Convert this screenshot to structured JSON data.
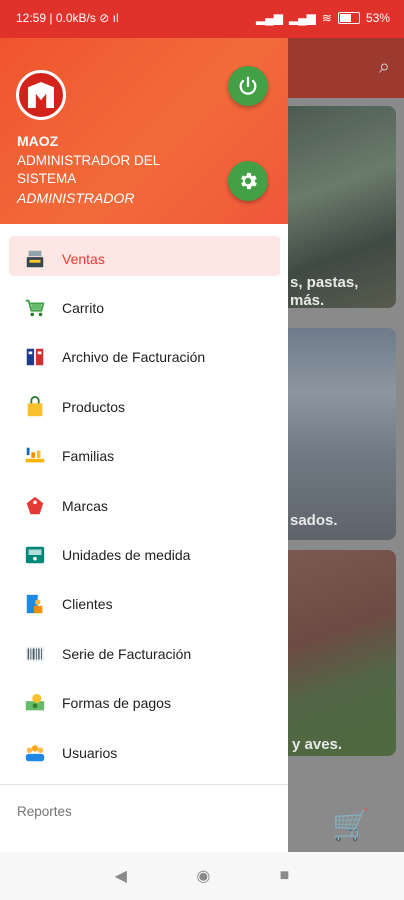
{
  "status_bar": {
    "time": "12:59",
    "network": "0.0kB/s",
    "battery": "53"
  },
  "background": {
    "card1_text": "s, pastas, más.",
    "card2_text": "sados.",
    "card3_text": "y aves."
  },
  "drawer": {
    "user": {
      "name": "MAOZ",
      "role": "ADMINISTRADOR DEL SISTEMA",
      "type": "ADMINISTRADOR"
    },
    "menu_items": [
      {
        "label": "Ventas",
        "icon": "cash-register-icon",
        "active": true
      },
      {
        "label": "Carrito",
        "icon": "cart-icon"
      },
      {
        "label": "Archivo de Facturación",
        "icon": "binders-icon"
      },
      {
        "label": "Productos",
        "icon": "shopping-bag-icon"
      },
      {
        "label": "Familias",
        "icon": "family-icon"
      },
      {
        "label": "Marcas",
        "icon": "tag-icon"
      },
      {
        "label": "Unidades de medida",
        "icon": "scale-icon"
      },
      {
        "label": "Clientes",
        "icon": "client-icon"
      },
      {
        "label": "Serie de Facturación",
        "icon": "barcode-icon"
      },
      {
        "label": "Formas de pagos",
        "icon": "money-icon"
      },
      {
        "label": "Usuarios",
        "icon": "users-icon"
      }
    ],
    "section_reportes": "Reportes"
  },
  "colors": {
    "header": "#f26b3a",
    "status_bar": "#e0322a",
    "action_button": "#43a047",
    "active_text": "#e53935",
    "active_bg": "#fde7e5"
  }
}
